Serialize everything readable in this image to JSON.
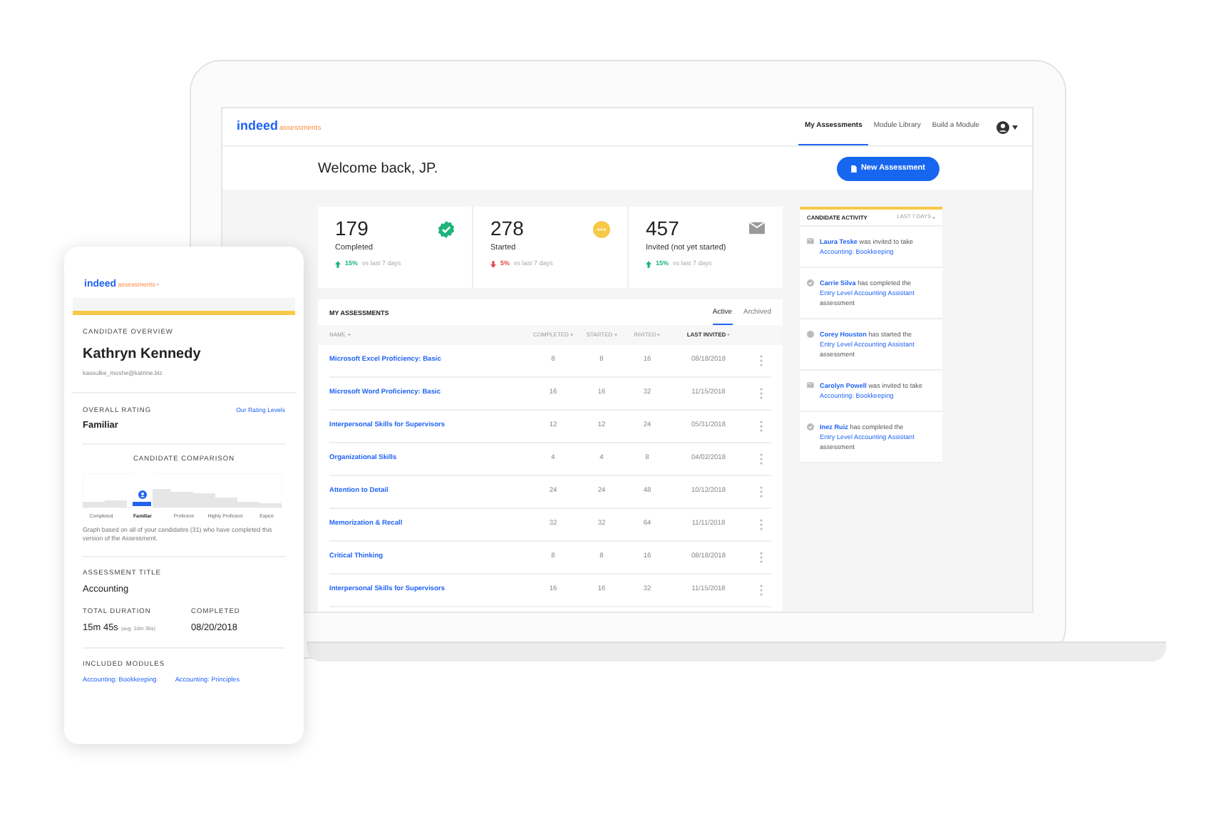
{
  "app": {
    "logo": {
      "brand": "indeed",
      "product": "assessments"
    },
    "nav_tabs": [
      {
        "label": "My Assessments",
        "selected": true
      },
      {
        "label": "Module Library",
        "selected": false
      },
      {
        "label": "Build a Module",
        "selected": false
      }
    ],
    "welcome": "Welcome back, JP.",
    "new_button": "New Assessment",
    "stats": [
      {
        "kind": "completed",
        "value": "179",
        "label": "Completed",
        "change": "15%",
        "increase": true,
        "comparison": "vs last 7 days"
      },
      {
        "kind": "started",
        "value": "278",
        "label": "Started",
        "change": "5%",
        "increase": false,
        "comparison": "vs last 7 days"
      },
      {
        "kind": "invited",
        "value": "457",
        "label": "Invited (not yet started)",
        "change": "15%",
        "increase": true,
        "comparison": "vs last 7 days"
      }
    ],
    "assessments": {
      "title": "MY ASSESSMENTS",
      "tabs": [
        {
          "label": "Active",
          "selected": true
        },
        {
          "label": "Archived",
          "selected": false
        }
      ],
      "columns": [
        {
          "label": "NAME",
          "selected": false
        },
        {
          "label": "COMPLETED",
          "selected": false
        },
        {
          "label": "STARTED",
          "selected": false
        },
        {
          "label": "INVITED",
          "selected": false
        },
        {
          "label": "LAST INVITED",
          "selected": true
        }
      ],
      "rows": [
        {
          "name": "Microsoft Excel Proficiency: Basic",
          "completed": "8",
          "started": "8",
          "invited": "16",
          "last_invited": "08/18/2018"
        },
        {
          "name": "Microsoft Word Proficiency: Basic",
          "completed": "16",
          "started": "16",
          "invited": "32",
          "last_invited": "11/15/2018"
        },
        {
          "name": "Interpersonal Skills for Supervisors",
          "completed": "12",
          "started": "12",
          "invited": "24",
          "last_invited": "05/31/2018"
        },
        {
          "name": "Organizational Skills",
          "completed": "4",
          "started": "4",
          "invited": "8",
          "last_invited": "04/02/2018"
        },
        {
          "name": "Attention to Detail",
          "completed": "24",
          "started": "24",
          "invited": "48",
          "last_invited": "10/12/2018"
        },
        {
          "name": "Memorization & Recall",
          "completed": "32",
          "started": "32",
          "invited": "64",
          "last_invited": "11/11/2018"
        },
        {
          "name": "Critical Thinking",
          "completed": "8",
          "started": "8",
          "invited": "16",
          "last_invited": "08/18/2018"
        },
        {
          "name": "Interpersonal Skills for Supervisors",
          "completed": "16",
          "started": "16",
          "invited": "32",
          "last_invited": "11/15/2018"
        }
      ]
    },
    "activity": {
      "title": "CANDIDATE ACTIVITY",
      "filter": "LAST 7 DAYS",
      "items": [
        {
          "kind": "invited",
          "name": "Laura Teske",
          "action": "was invited to take",
          "target": "Accounting: Bookkeeping"
        },
        {
          "kind": "completed",
          "name": "Carrie Silva",
          "action": "has completed the",
          "target": "Entry Level Accounting Assistant",
          "suffix": "assessment"
        },
        {
          "kind": "started",
          "name": "Corey Houston",
          "action": "has started the",
          "target": "Entry Level Accounting Assistant",
          "suffix": "assessment"
        },
        {
          "kind": "invited",
          "name": "Carolyn Powell",
          "action": "was invited to take",
          "target": "Accounting: Bookkeeping"
        },
        {
          "kind": "completed",
          "name": "Inez Ruiz",
          "action": "has completed the",
          "target": "Entry Level Accounting Assistant",
          "suffix": "assessment"
        }
      ]
    }
  },
  "mobile": {
    "logo": {
      "brand": "indeed",
      "product": "assessments",
      "mark": "™"
    },
    "section_title": "CANDIDATE OVERVIEW",
    "candidate_name": "Kathryn Kennedy",
    "email": "kassulke_moshe@katrine.biz",
    "rating_label": "OVERALL RATING",
    "rating_link": "Our Rating Levels",
    "rating": "Familiar",
    "comparison_title": "CANDIDATE COMPARISON",
    "levels": [
      {
        "label": "Completed",
        "selected": false
      },
      {
        "label": "Familiar",
        "selected": true
      },
      {
        "label": "Proficient",
        "selected": false
      },
      {
        "label": "Highly Proficient",
        "selected": false
      },
      {
        "label": "Expert",
        "selected": false
      }
    ],
    "graph_note": "Graph based on all of your candidates (31) who have completed this version of the Assessment.",
    "assessment_label": "ASSESSMENT TITLE",
    "assessment": "Accounting",
    "duration_label": "TOTAL DURATION",
    "duration": "15m 45s",
    "duration_avg": "(avg. 10m 36s)",
    "completed_label": "COMPLETED",
    "completed": "08/20/2018",
    "modules_label": "INCLUDED MODULES",
    "modules": [
      "Accounting: Bookkeeping",
      "Accounting: Principles"
    ]
  }
}
